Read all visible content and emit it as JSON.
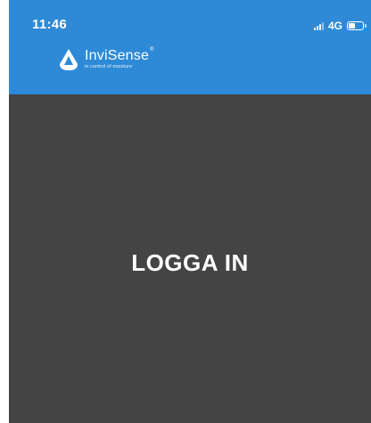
{
  "status_bar": {
    "time": "11:46",
    "network": "4G",
    "battery_level": 0.45
  },
  "brand": {
    "name": "InviSense",
    "registered_mark": "®",
    "tagline": "in control of moisture",
    "icon": "invisense-drop-logo-icon"
  },
  "main": {
    "login_label": "LOGGA IN"
  },
  "colors": {
    "header": "#2e8ad6",
    "background": "#444444",
    "text": "#ffffff"
  }
}
